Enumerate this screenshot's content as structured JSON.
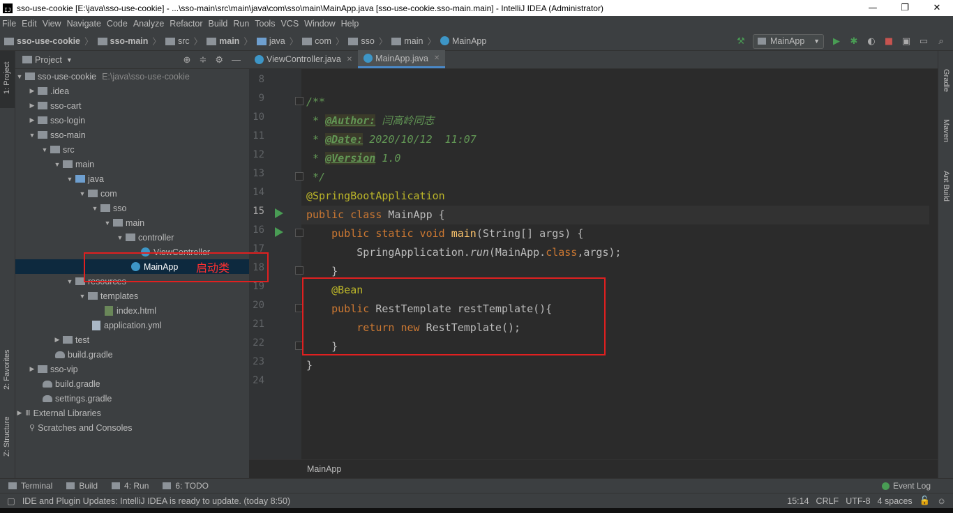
{
  "window": {
    "title": "sso-use-cookie [E:\\java\\sso-use-cookie] - ...\\sso-main\\src\\main\\java\\com\\sso\\main\\MainApp.java [sso-use-cookie.sso-main.main] - IntelliJ IDEA (Administrator)",
    "minimize": "—",
    "maximize": "❐",
    "close": "✕"
  },
  "menu": [
    "File",
    "Edit",
    "View",
    "Navigate",
    "Code",
    "Analyze",
    "Refactor",
    "Build",
    "Run",
    "Tools",
    "VCS",
    "Window",
    "Help"
  ],
  "breadcrumbs": [
    "sso-use-cookie",
    "sso-main",
    "src",
    "main",
    "java",
    "com",
    "sso",
    "main",
    "MainApp"
  ],
  "toolbar": {
    "run_config": "MainApp"
  },
  "left_strip": {
    "project": "1: Project",
    "favorites": "2: Favorites",
    "structure": "Z: Structure"
  },
  "right_strip": {
    "gradle": "Gradle",
    "maven": "Maven",
    "ant": "Ant Build"
  },
  "project_panel": {
    "title": "Project"
  },
  "tree": [
    {
      "label": "sso-use-cookie",
      "extra": "E:\\java\\sso-use-cookie"
    },
    {
      "label": ".idea"
    },
    {
      "label": "sso-cart"
    },
    {
      "label": "sso-login"
    },
    {
      "label": "sso-main"
    },
    {
      "label": "src"
    },
    {
      "label": "main"
    },
    {
      "label": "java"
    },
    {
      "label": "com"
    },
    {
      "label": "sso"
    },
    {
      "label": "main"
    },
    {
      "label": "controller"
    },
    {
      "label": "ViewController"
    },
    {
      "label": "MainApp"
    },
    {
      "label": "resources"
    },
    {
      "label": "templates"
    },
    {
      "label": "index.html"
    },
    {
      "label": "application.yml"
    },
    {
      "label": "test"
    },
    {
      "label": "build.gradle"
    },
    {
      "label": "sso-vip"
    },
    {
      "label": "build.gradle"
    },
    {
      "label": "settings.gradle"
    },
    {
      "label": "External Libraries"
    },
    {
      "label": "Scratches and Consoles"
    }
  ],
  "tabs": [
    {
      "label": "ViewController.java"
    },
    {
      "label": "MainApp.java"
    }
  ],
  "line_numbers": [
    "8",
    "9",
    "10",
    "11",
    "12",
    "13",
    "14",
    "15",
    "16",
    "17",
    "18",
    "19",
    "20",
    "21",
    "22",
    "23",
    "24"
  ],
  "code": {
    "l9": "/**",
    "l10_tag": "@Author:",
    "l10_val": " 闫高岭同志",
    "l11_tag": "@Date:",
    "l11_val": " 2020/10/12  11:07",
    "l12_tag": "@Version",
    "l12_val": " 1.0",
    "l13": " */",
    "l14": "@SpringBootApplication",
    "l15_kw": "public class ",
    "l15_name": "MainApp",
    " l15_rest": " {",
    "l16_kw": "public static void ",
    "l16_fn": "main",
    "l16_rest": "(String[] args) {",
    "l17_a": "SpringApplication.",
    "l17_b": "run",
    "l17_c": "(MainApp.",
    "l17_d": "class",
    "l17_e": ",args);",
    "l18": "}",
    "l19": "@Bean",
    "l20_kw": "public ",
    "l20_rest": "RestTemplate restTemplate(){",
    "l21_kw": "return new ",
    "l21_rest": "RestTemplate();",
    "l22": "}",
    "l23": "}"
  },
  "editor_breadcrumb": "MainApp",
  "annotation_label": "启动类",
  "tool_windows": [
    "Terminal",
    "Build",
    "4: Run",
    "6: TODO"
  ],
  "event_log": "Event Log",
  "status": {
    "message": "IDE and Plugin Updates: IntelliJ IDEA is ready to update. (today 8:50)",
    "position": "15:14",
    "line_sep": "CRLF",
    "encoding": "UTF-8",
    "indent": "4 spaces"
  }
}
